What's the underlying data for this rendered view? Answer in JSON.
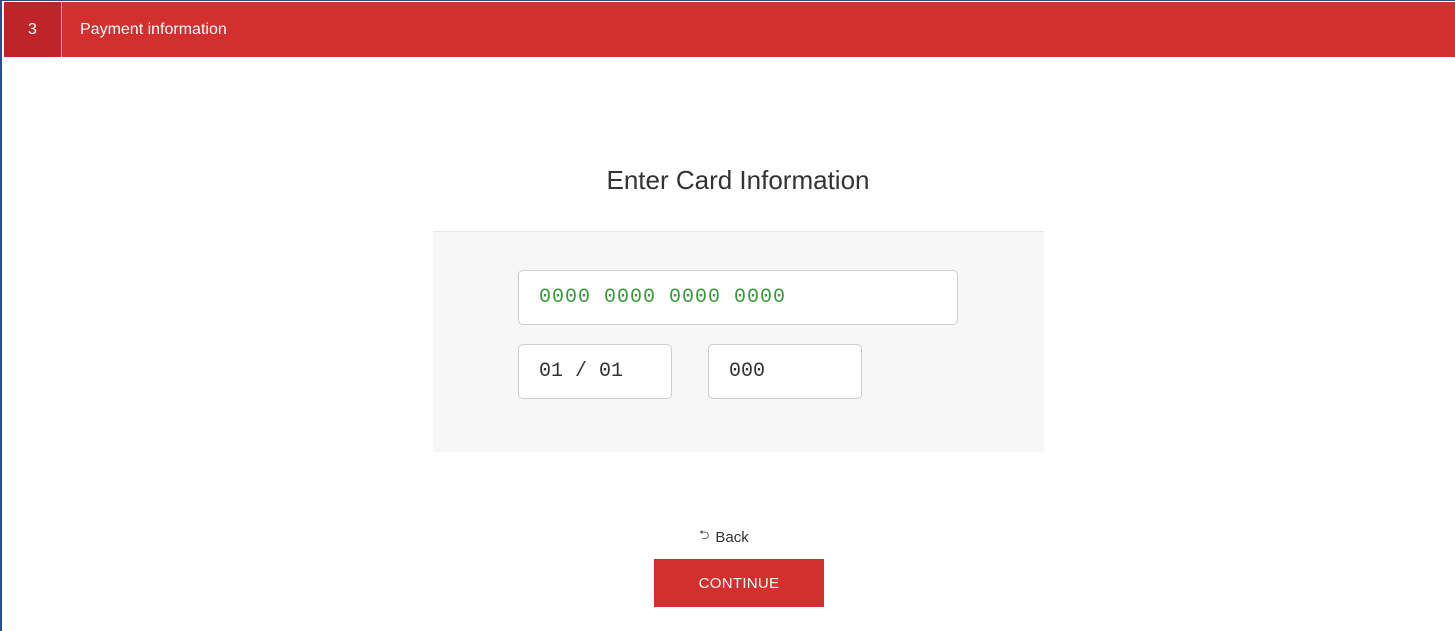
{
  "step": {
    "number": "3",
    "title": "Payment information"
  },
  "form": {
    "heading": "Enter Card Information",
    "card_number": "0000 0000 0000 0000",
    "expiry": "01 / 01",
    "cvc": "000"
  },
  "actions": {
    "back_icon": "⮌",
    "back_label": "Back",
    "continue_label": "CONTINUE"
  },
  "colors": {
    "header_red": "#d32f2f",
    "step_number_red": "#bf2528",
    "card_number_green": "#3a9a3a",
    "panel_gray": "#f7f7f7"
  }
}
